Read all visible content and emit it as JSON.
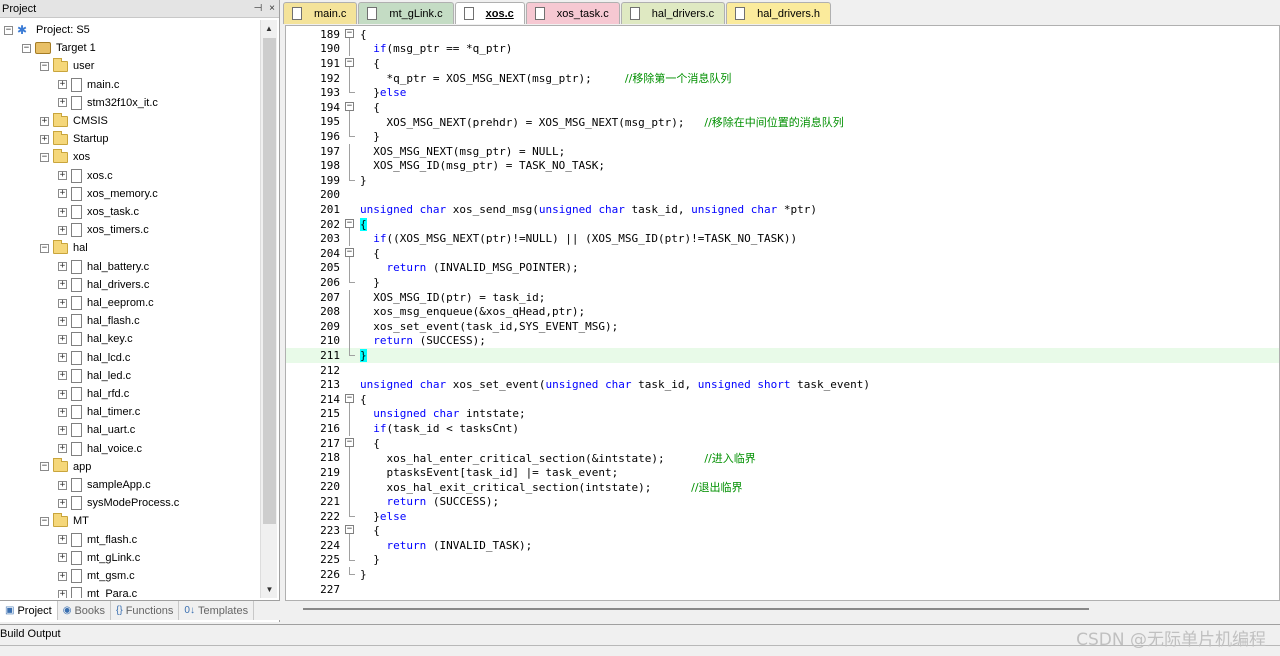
{
  "project_panel": {
    "title": "Project",
    "controls": [
      "⊣",
      "×"
    ],
    "tree": [
      {
        "label": "Project: S5",
        "depth": 0,
        "kind": "project",
        "expander": "−"
      },
      {
        "label": "Target 1",
        "depth": 1,
        "kind": "target",
        "expander": "−"
      },
      {
        "label": "user",
        "depth": 2,
        "kind": "folder",
        "expander": "−"
      },
      {
        "label": "main.c",
        "depth": 3,
        "kind": "file",
        "expander": "+"
      },
      {
        "label": "stm32f10x_it.c",
        "depth": 3,
        "kind": "file",
        "expander": "+"
      },
      {
        "label": "CMSIS",
        "depth": 2,
        "kind": "folder",
        "expander": "+"
      },
      {
        "label": "Startup",
        "depth": 2,
        "kind": "folder",
        "expander": "+"
      },
      {
        "label": "xos",
        "depth": 2,
        "kind": "folder",
        "expander": "−"
      },
      {
        "label": "xos.c",
        "depth": 3,
        "kind": "file",
        "expander": "+"
      },
      {
        "label": "xos_memory.c",
        "depth": 3,
        "kind": "file",
        "expander": "+"
      },
      {
        "label": "xos_task.c",
        "depth": 3,
        "kind": "file",
        "expander": "+"
      },
      {
        "label": "xos_timers.c",
        "depth": 3,
        "kind": "file",
        "expander": "+"
      },
      {
        "label": "hal",
        "depth": 2,
        "kind": "folder",
        "expander": "−"
      },
      {
        "label": "hal_battery.c",
        "depth": 3,
        "kind": "file",
        "expander": "+"
      },
      {
        "label": "hal_drivers.c",
        "depth": 3,
        "kind": "file",
        "expander": "+"
      },
      {
        "label": "hal_eeprom.c",
        "depth": 3,
        "kind": "file",
        "expander": "+"
      },
      {
        "label": "hal_flash.c",
        "depth": 3,
        "kind": "file",
        "expander": "+"
      },
      {
        "label": "hal_key.c",
        "depth": 3,
        "kind": "file",
        "expander": "+"
      },
      {
        "label": "hal_lcd.c",
        "depth": 3,
        "kind": "file",
        "expander": "+"
      },
      {
        "label": "hal_led.c",
        "depth": 3,
        "kind": "file",
        "expander": "+"
      },
      {
        "label": "hal_rfd.c",
        "depth": 3,
        "kind": "file",
        "expander": "+"
      },
      {
        "label": "hal_timer.c",
        "depth": 3,
        "kind": "file",
        "expander": "+"
      },
      {
        "label": "hal_uart.c",
        "depth": 3,
        "kind": "file",
        "expander": "+"
      },
      {
        "label": "hal_voice.c",
        "depth": 3,
        "kind": "file",
        "expander": "+"
      },
      {
        "label": "app",
        "depth": 2,
        "kind": "folder",
        "expander": "−"
      },
      {
        "label": "sampleApp.c",
        "depth": 3,
        "kind": "file",
        "expander": "+"
      },
      {
        "label": "sysModeProcess.c",
        "depth": 3,
        "kind": "file",
        "expander": "+"
      },
      {
        "label": "MT",
        "depth": 2,
        "kind": "folder",
        "expander": "−"
      },
      {
        "label": "mt_flash.c",
        "depth": 3,
        "kind": "file",
        "expander": "+"
      },
      {
        "label": "mt_gLink.c",
        "depth": 3,
        "kind": "file",
        "expander": "+"
      },
      {
        "label": "mt_gsm.c",
        "depth": 3,
        "kind": "file",
        "expander": "+"
      },
      {
        "label": "mt_Para.c",
        "depth": 3,
        "kind": "file",
        "expander": "+"
      }
    ],
    "tabs": [
      {
        "label": "Project",
        "icon": "project-icon",
        "active": true
      },
      {
        "label": "Books",
        "icon": "books-icon",
        "active": false
      },
      {
        "label": "Functions",
        "icon": "functions-icon",
        "active": false
      },
      {
        "label": "Templates",
        "icon": "templates-icon",
        "active": false
      }
    ]
  },
  "editor": {
    "tabs": [
      {
        "label": "main.c",
        "color": "#f4e39a",
        "active": false
      },
      {
        "label": "mt_gLink.c",
        "color": "#c4dcc4",
        "active": false
      },
      {
        "label": "xos.c",
        "color": "#ffffff",
        "active": true
      },
      {
        "label": "xos_task.c",
        "color": "#f6c8d2",
        "active": false
      },
      {
        "label": "hal_drivers.c",
        "color": "#dfe9c2",
        "active": false
      },
      {
        "label": "hal_drivers.h",
        "color": "#fbeb9c",
        "active": false
      }
    ],
    "lines": [
      {
        "n": "189",
        "fold": "box",
        "segs": [
          {
            "t": "{"
          }
        ]
      },
      {
        "n": "190",
        "fold": "line",
        "segs": [
          {
            "t": "  "
          },
          {
            "t": "if",
            "c": "kw"
          },
          {
            "t": "(msg_ptr == *q_ptr)"
          }
        ]
      },
      {
        "n": "191",
        "fold": "box",
        "segs": [
          {
            "t": "  {"
          }
        ]
      },
      {
        "n": "192",
        "fold": "line",
        "segs": [
          {
            "t": "    *q_ptr = XOS_MSG_NEXT(msg_ptr);     "
          },
          {
            "t": "//移除第一个消息队列",
            "c": "cm"
          }
        ]
      },
      {
        "n": "193",
        "fold": "end",
        "segs": [
          {
            "t": "  }"
          },
          {
            "t": "else",
            "c": "kw"
          }
        ]
      },
      {
        "n": "194",
        "fold": "box",
        "segs": [
          {
            "t": "  {"
          }
        ]
      },
      {
        "n": "195",
        "fold": "line",
        "segs": [
          {
            "t": "    XOS_MSG_NEXT(prehdr) = XOS_MSG_NEXT(msg_ptr);   "
          },
          {
            "t": "//移除在中间位置的消息队列",
            "c": "cm"
          }
        ]
      },
      {
        "n": "196",
        "fold": "end",
        "segs": [
          {
            "t": "  }"
          }
        ]
      },
      {
        "n": "197",
        "fold": "line",
        "segs": [
          {
            "t": "  XOS_MSG_NEXT(msg_ptr) = NULL;"
          }
        ]
      },
      {
        "n": "198",
        "fold": "line",
        "segs": [
          {
            "t": "  XOS_MSG_ID(msg_ptr) = TASK_NO_TASK;"
          }
        ]
      },
      {
        "n": "199",
        "fold": "end",
        "segs": [
          {
            "t": "}"
          }
        ]
      },
      {
        "n": "200",
        "fold": "none",
        "segs": [
          {
            "t": ""
          }
        ]
      },
      {
        "n": "201",
        "fold": "none",
        "segs": [
          {
            "t": "unsigned",
            "c": "kw"
          },
          {
            "t": " "
          },
          {
            "t": "char",
            "c": "kw"
          },
          {
            "t": " xos_send_msg("
          },
          {
            "t": "unsigned",
            "c": "kw"
          },
          {
            "t": " "
          },
          {
            "t": "char",
            "c": "kw"
          },
          {
            "t": " task_id, "
          },
          {
            "t": "unsigned",
            "c": "kw"
          },
          {
            "t": " "
          },
          {
            "t": "char",
            "c": "kw"
          },
          {
            "t": " *ptr)"
          }
        ]
      },
      {
        "n": "202",
        "fold": "box",
        "segs": [
          {
            "t": "{",
            "c": "brk"
          }
        ]
      },
      {
        "n": "203",
        "fold": "line",
        "segs": [
          {
            "t": "  "
          },
          {
            "t": "if",
            "c": "kw"
          },
          {
            "t": "((XOS_MSG_NEXT(ptr)!=NULL) || (XOS_MSG_ID(ptr)!=TASK_NO_TASK))"
          }
        ]
      },
      {
        "n": "204",
        "fold": "box",
        "segs": [
          {
            "t": "  {"
          }
        ]
      },
      {
        "n": "205",
        "fold": "line",
        "segs": [
          {
            "t": "    "
          },
          {
            "t": "return",
            "c": "kw"
          },
          {
            "t": " (INVALID_MSG_POINTER);"
          }
        ]
      },
      {
        "n": "206",
        "fold": "end",
        "segs": [
          {
            "t": "  }"
          }
        ]
      },
      {
        "n": "207",
        "fold": "line",
        "segs": [
          {
            "t": "  XOS_MSG_ID(ptr) = task_id;"
          }
        ]
      },
      {
        "n": "208",
        "fold": "line",
        "segs": [
          {
            "t": "  xos_msg_enqueue(&xos_qHead,ptr);"
          }
        ]
      },
      {
        "n": "209",
        "fold": "line",
        "segs": [
          {
            "t": "  xos_set_event(task_id,SYS_EVENT_MSG);"
          }
        ]
      },
      {
        "n": "210",
        "fold": "line",
        "segs": [
          {
            "t": "  "
          },
          {
            "t": "return",
            "c": "kw"
          },
          {
            "t": " (SUCCESS);"
          }
        ]
      },
      {
        "n": "211",
        "fold": "end",
        "hl": true,
        "segs": [
          {
            "t": "}",
            "c": "brk"
          }
        ]
      },
      {
        "n": "212",
        "fold": "none",
        "segs": [
          {
            "t": ""
          }
        ]
      },
      {
        "n": "213",
        "fold": "none",
        "segs": [
          {
            "t": "unsigned",
            "c": "kw"
          },
          {
            "t": " "
          },
          {
            "t": "char",
            "c": "kw"
          },
          {
            "t": " xos_set_event("
          },
          {
            "t": "unsigned",
            "c": "kw"
          },
          {
            "t": " "
          },
          {
            "t": "char",
            "c": "kw"
          },
          {
            "t": " task_id, "
          },
          {
            "t": "unsigned",
            "c": "kw"
          },
          {
            "t": " "
          },
          {
            "t": "short",
            "c": "kw"
          },
          {
            "t": " task_event)"
          }
        ]
      },
      {
        "n": "214",
        "fold": "box",
        "segs": [
          {
            "t": "{"
          }
        ]
      },
      {
        "n": "215",
        "fold": "line",
        "segs": [
          {
            "t": "  "
          },
          {
            "t": "unsigned",
            "c": "kw"
          },
          {
            "t": " "
          },
          {
            "t": "char",
            "c": "kw"
          },
          {
            "t": " intstate;"
          }
        ]
      },
      {
        "n": "216",
        "fold": "line",
        "segs": [
          {
            "t": "  "
          },
          {
            "t": "if",
            "c": "kw"
          },
          {
            "t": "(task_id < tasksCnt)"
          }
        ]
      },
      {
        "n": "217",
        "fold": "box",
        "segs": [
          {
            "t": "  {"
          }
        ]
      },
      {
        "n": "218",
        "fold": "line",
        "segs": [
          {
            "t": "    xos_hal_enter_critical_section(&intstate);      "
          },
          {
            "t": "//进入临界",
            "c": "cm"
          }
        ]
      },
      {
        "n": "219",
        "fold": "line",
        "segs": [
          {
            "t": "    ptasksEvent[task_id] |= task_event;"
          }
        ]
      },
      {
        "n": "220",
        "fold": "line",
        "segs": [
          {
            "t": "    xos_hal_exit_critical_section(intstate);      "
          },
          {
            "t": "//退出临界",
            "c": "cm"
          }
        ]
      },
      {
        "n": "221",
        "fold": "line",
        "segs": [
          {
            "t": "    "
          },
          {
            "t": "return",
            "c": "kw"
          },
          {
            "t": " (SUCCESS);"
          }
        ]
      },
      {
        "n": "222",
        "fold": "end",
        "segs": [
          {
            "t": "  }"
          },
          {
            "t": "else",
            "c": "kw"
          }
        ]
      },
      {
        "n": "223",
        "fold": "box",
        "segs": [
          {
            "t": "  {"
          }
        ]
      },
      {
        "n": "224",
        "fold": "line",
        "segs": [
          {
            "t": "    "
          },
          {
            "t": "return",
            "c": "kw"
          },
          {
            "t": " (INVALID_TASK);"
          }
        ]
      },
      {
        "n": "225",
        "fold": "end",
        "segs": [
          {
            "t": "  }"
          }
        ]
      },
      {
        "n": "226",
        "fold": "end",
        "segs": [
          {
            "t": "}"
          }
        ]
      },
      {
        "n": "227",
        "fold": "none",
        "segs": [
          {
            "t": ""
          }
        ]
      }
    ]
  },
  "build_output": {
    "title": "Build Output"
  },
  "watermark": "CSDN @无际单片机编程",
  "colors": {
    "keyword": "#0000ff",
    "comment": "#009000",
    "current_line": "#e8fae8",
    "brace_match": "#00ffff"
  }
}
